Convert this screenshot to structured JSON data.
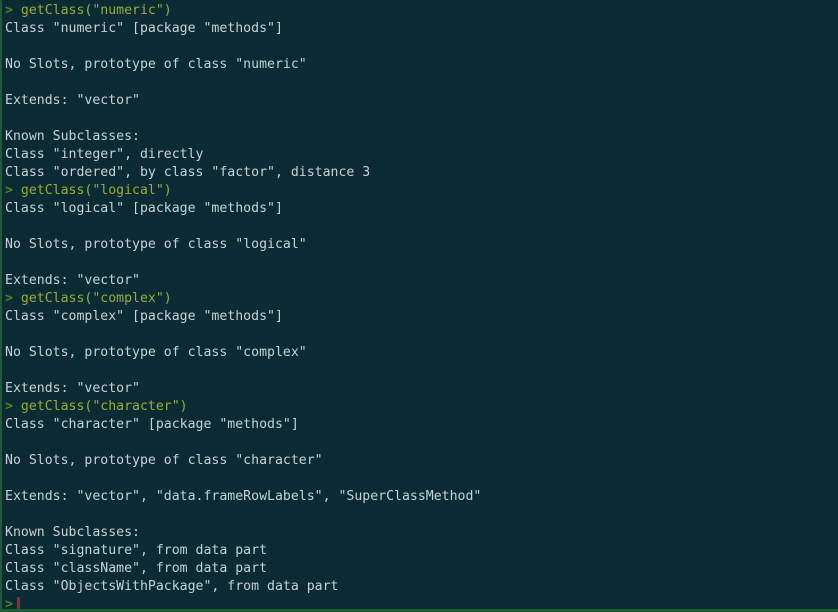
{
  "terminal": {
    "colors": {
      "background": "#0b2b34",
      "output_text": "#c6d2d6",
      "prompt": "#55821f",
      "command_text": "#9aab3a",
      "cursor": "#a32626",
      "border": "#1d5c36"
    },
    "prompt_symbol": ">",
    "lines": [
      {
        "type": "command",
        "prompt": ">",
        "text": " getClass(\"numeric\")"
      },
      {
        "type": "output",
        "text": "Class \"numeric\" [package \"methods\"]"
      },
      {
        "type": "blank",
        "text": ""
      },
      {
        "type": "output",
        "text": "No Slots, prototype of class \"numeric\""
      },
      {
        "type": "blank",
        "text": ""
      },
      {
        "type": "output",
        "text": "Extends: \"vector\""
      },
      {
        "type": "blank",
        "text": ""
      },
      {
        "type": "output",
        "text": "Known Subclasses:"
      },
      {
        "type": "output",
        "text": "Class \"integer\", directly"
      },
      {
        "type": "output",
        "text": "Class \"ordered\", by class \"factor\", distance 3"
      },
      {
        "type": "command",
        "prompt": ">",
        "text": " getClass(\"logical\")"
      },
      {
        "type": "output",
        "text": "Class \"logical\" [package \"methods\"]"
      },
      {
        "type": "blank",
        "text": ""
      },
      {
        "type": "output",
        "text": "No Slots, prototype of class \"logical\""
      },
      {
        "type": "blank",
        "text": ""
      },
      {
        "type": "output",
        "text": "Extends: \"vector\""
      },
      {
        "type": "command",
        "prompt": ">",
        "text": " getClass(\"complex\")"
      },
      {
        "type": "output",
        "text": "Class \"complex\" [package \"methods\"]"
      },
      {
        "type": "blank",
        "text": ""
      },
      {
        "type": "output",
        "text": "No Slots, prototype of class \"complex\""
      },
      {
        "type": "blank",
        "text": ""
      },
      {
        "type": "output",
        "text": "Extends: \"vector\""
      },
      {
        "type": "command",
        "prompt": ">",
        "text": " getClass(\"character\")"
      },
      {
        "type": "output",
        "text": "Class \"character\" [package \"methods\"]"
      },
      {
        "type": "blank",
        "text": ""
      },
      {
        "type": "output",
        "text": "No Slots, prototype of class \"character\""
      },
      {
        "type": "blank",
        "text": ""
      },
      {
        "type": "output",
        "text": "Extends: \"vector\", \"data.frameRowLabels\", \"SuperClassMethod\""
      },
      {
        "type": "blank",
        "text": ""
      },
      {
        "type": "output",
        "text": "Known Subclasses:"
      },
      {
        "type": "output",
        "text": "Class \"signature\", from data part"
      },
      {
        "type": "output",
        "text": "Class \"className\", from data part"
      },
      {
        "type": "output",
        "text": "Class \"ObjectsWithPackage\", from data part"
      },
      {
        "type": "cursorprompt",
        "prompt": ">",
        "text": ""
      }
    ]
  }
}
